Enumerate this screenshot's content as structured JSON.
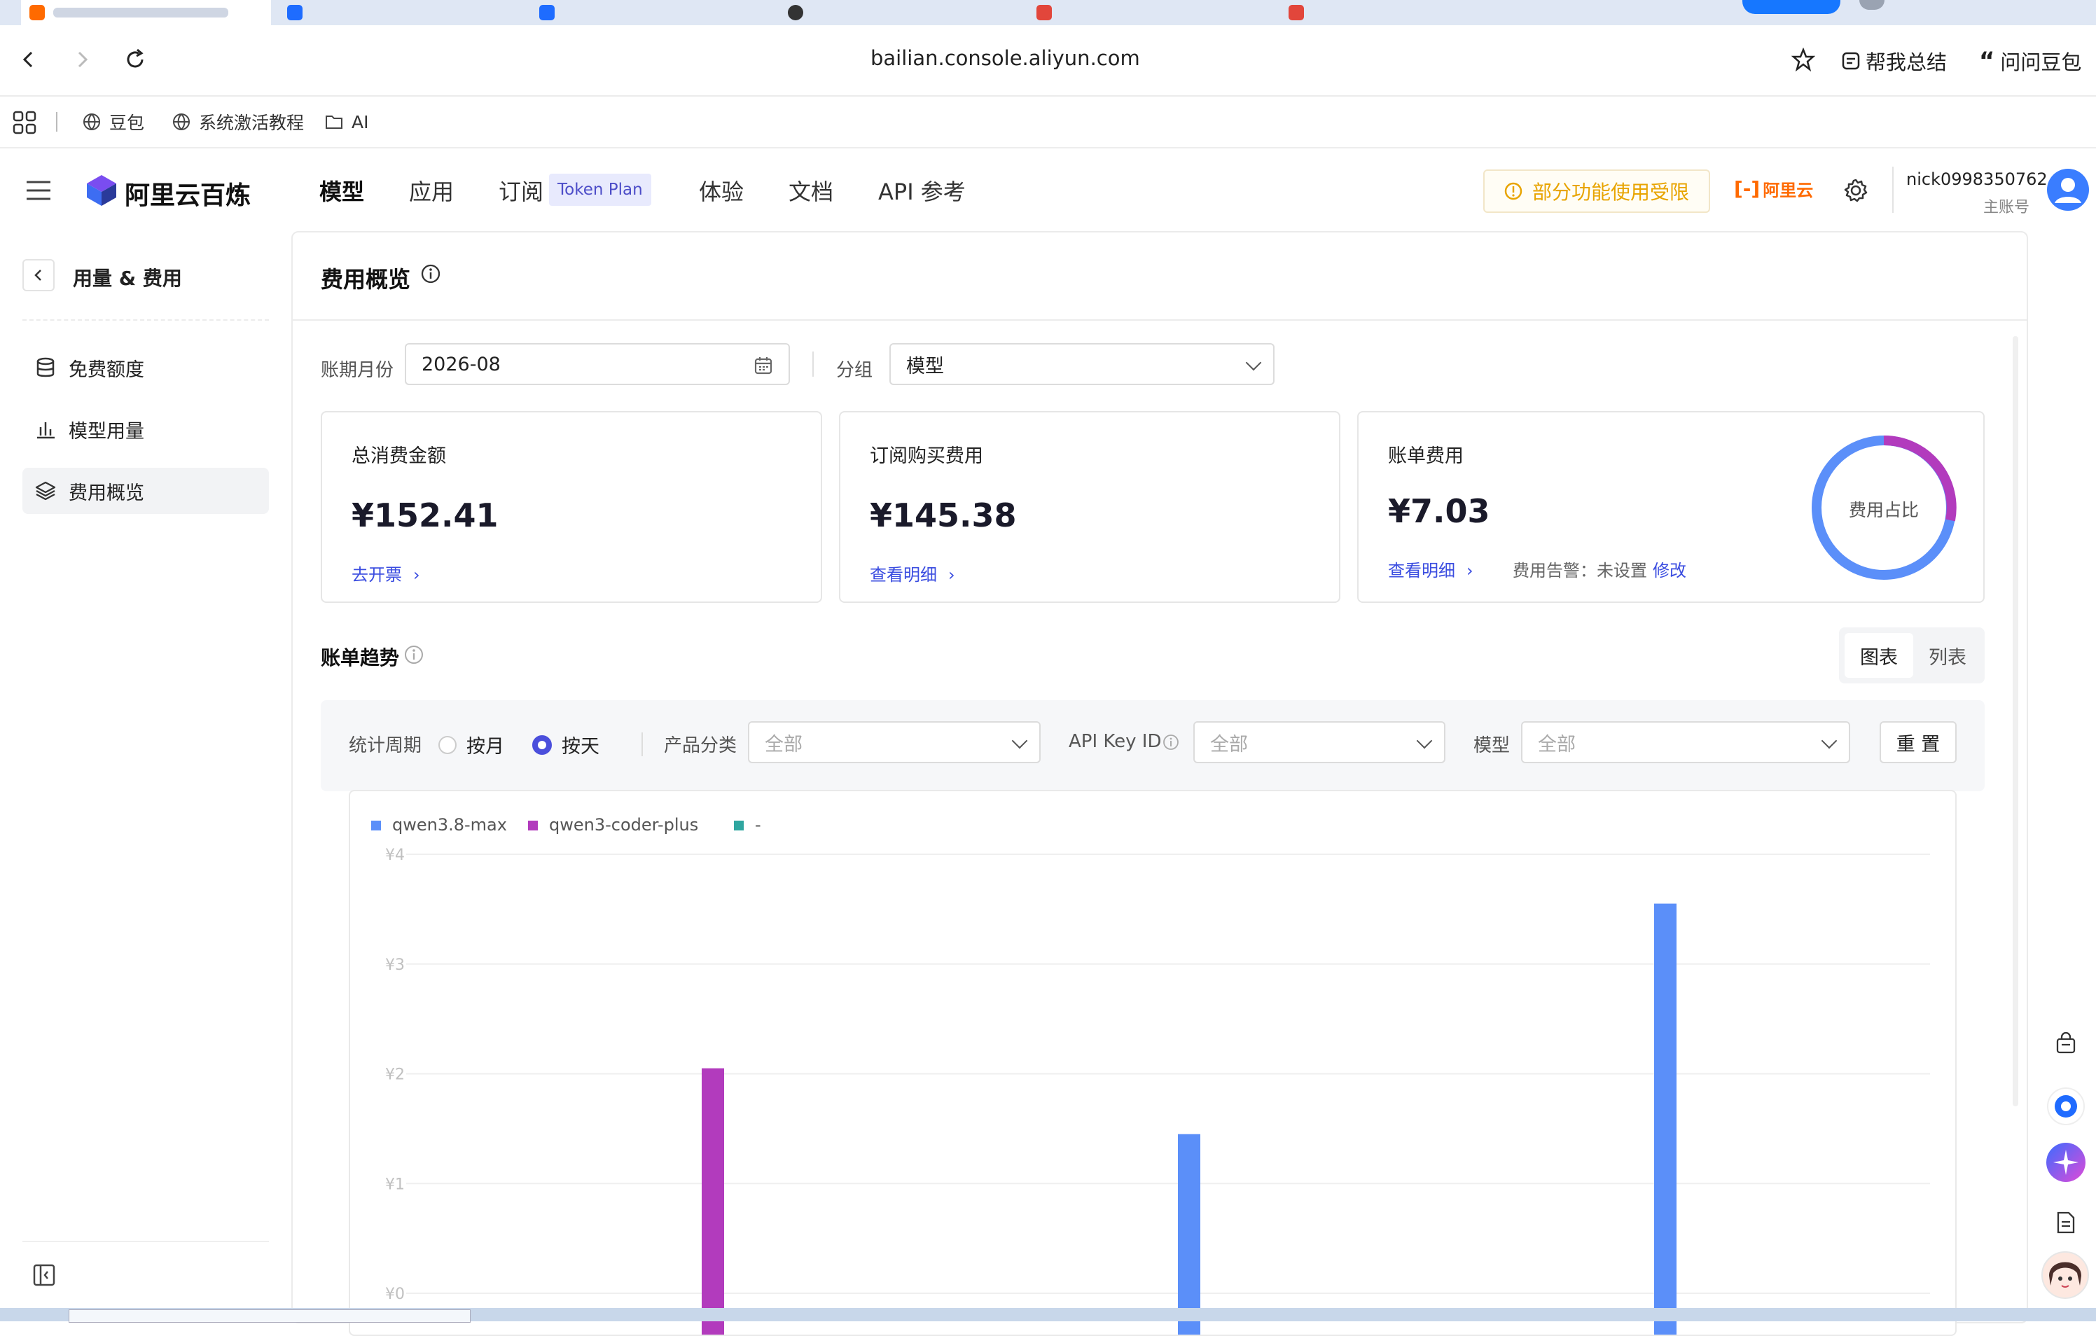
{
  "browser": {
    "address": "bailian.console.aliyun.com",
    "actions": {
      "summarize": "帮我总结",
      "ask": "问问豆包"
    },
    "bookmarks": [
      "豆包",
      "系统激活教程",
      "AI"
    ]
  },
  "header": {
    "brand": "阿里云百炼",
    "nav": [
      "模型",
      "应用",
      "订阅",
      "体验",
      "文档",
      "API 参考"
    ],
    "token_badge": "Token Plan",
    "limit_notice": "部分功能使用受限",
    "aliyun_logo": "阿里云",
    "username": "nick0998350762",
    "account_type": "主账号"
  },
  "sidebar": {
    "back_title": "用量 & 费用",
    "items": [
      {
        "label": "免费额度",
        "icon": "database-icon"
      },
      {
        "label": "模型用量",
        "icon": "bar-chart-icon"
      },
      {
        "label": "费用概览",
        "icon": "layers-icon"
      }
    ],
    "active_index": 2
  },
  "main": {
    "title": "费用概览",
    "filters": {
      "period_label": "账期月份",
      "period_value": "2026-08",
      "group_label": "分组",
      "group_value": "模型"
    },
    "cards": [
      {
        "title": "总消费金额",
        "amount": "¥152.41",
        "link": "去开票"
      },
      {
        "title": "订阅购买费用",
        "amount": "¥145.38",
        "link": "查看明细"
      },
      {
        "title": "账单费用",
        "amount": "¥7.03",
        "link": "查看明细",
        "alert_label": "费用告警：未设置",
        "alert_action": "修改",
        "donut_label": "费用占比"
      }
    ],
    "trend": {
      "title": "账单趋势",
      "view_toggle": [
        "图表",
        "列表"
      ],
      "active_view": 0,
      "period_label": "统计周期",
      "period_options": [
        "按月",
        "按天"
      ],
      "period_selected": 1,
      "product_label": "产品分类",
      "product_value": "全部",
      "apikey_label": "API Key ID",
      "apikey_value": "全部",
      "model_label": "模型",
      "model_value": "全部",
      "reset": "重 置"
    }
  },
  "colors": {
    "accent": "#3b4de0",
    "series_blue": "#5b8ff9",
    "series_purple": "#b23bbd",
    "series_teal": "#2fa6a0",
    "warning": "#e8a400"
  },
  "chart_data": {
    "type": "bar",
    "series": [
      {
        "name": "qwen3.8-max",
        "color": "#5b8ff9",
        "points": [
          {
            "slot": 2,
            "value": 1.45
          },
          {
            "slot": 3,
            "value": 3.55
          }
        ]
      },
      {
        "name": "qwen3-coder-plus",
        "color": "#b23bbd",
        "points": [
          {
            "slot": 1,
            "value": 2.05
          }
        ]
      },
      {
        "name": "-",
        "color": "#2fa6a0",
        "points": []
      }
    ],
    "ylim": [
      0,
      4
    ],
    "yticks": [
      "¥0",
      "¥1",
      "¥2",
      "¥3",
      "¥4"
    ],
    "grid": true,
    "legend": "top-left"
  }
}
